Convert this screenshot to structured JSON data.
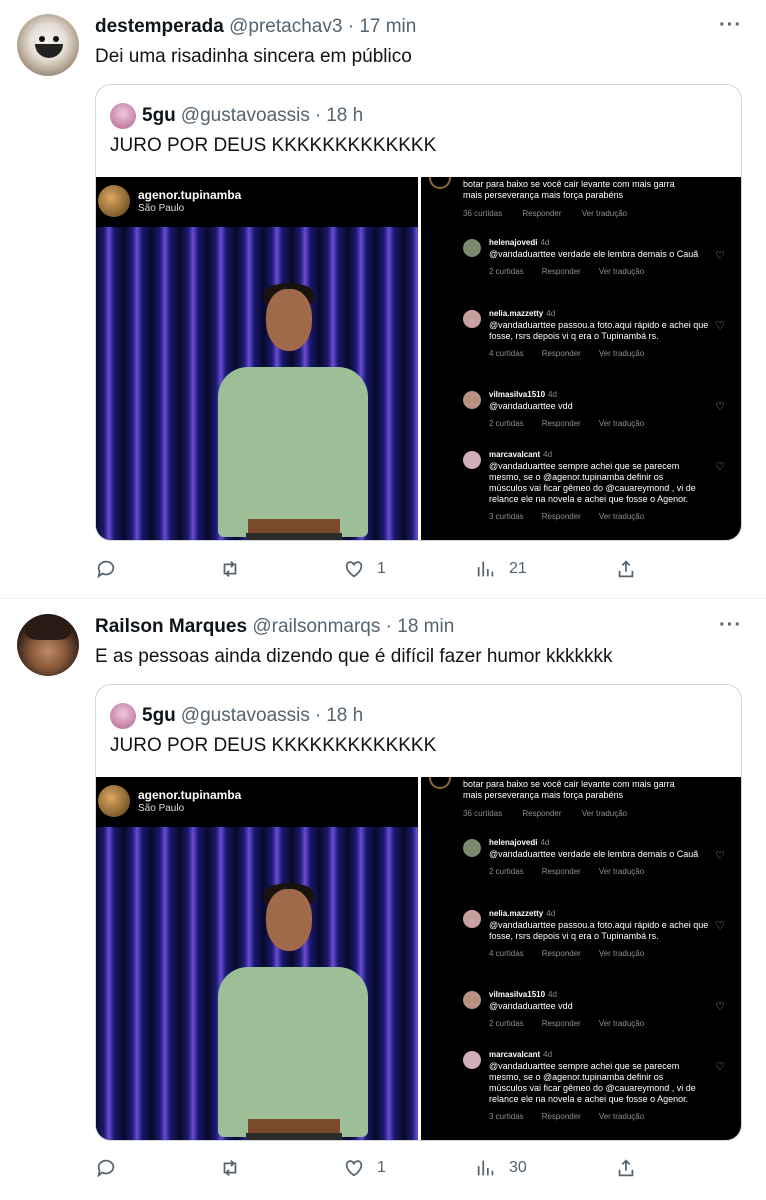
{
  "tweets": [
    {
      "name": "destemperada",
      "handle": "@pretachav3",
      "time": "17 min",
      "text": "Dei uma risadinha sincera em público",
      "quote": {
        "name": "5gu",
        "handle": "@gustavoassis",
        "time": "18 h",
        "text": "JURO POR DEUS KKKKKKKKKKKKK"
      },
      "stats": {
        "replies": "",
        "retweets": "",
        "likes": "1",
        "views": "21"
      }
    },
    {
      "name": "Railson Marques",
      "handle": "@railsonmarqs",
      "time": "18 min",
      "text": "E as pessoas ainda dizendo que é difícil fazer humor kkkkkkk",
      "quote": {
        "name": "5gu",
        "handle": "@gustavoassis",
        "time": "18 h",
        "text": "JURO POR DEUS KKKKKKKKKKKKK"
      },
      "stats": {
        "replies": "",
        "retweets": "",
        "likes": "1",
        "views": "30"
      }
    }
  ],
  "media": {
    "ig_user": "agenor.tupinamba",
    "ig_location": "São Paulo",
    "top_comment_1": "botar para baixo se você cair levante com mais garra",
    "top_comment_2": "mais perseverança mais força parabéns",
    "top_meta": {
      "likes": "36 curtidas",
      "reply": "Responder",
      "translate": "Ver tradução"
    },
    "comments": [
      {
        "user": "helenajovedi",
        "age": "4d",
        "text": "@vandaduarttee verdade ele lembra demais o Cauã",
        "likes": "2 curtidas"
      },
      {
        "user": "nelia.mazzetty",
        "age": "4d",
        "text": "@vandaduarttee passou.a foto.aqui rápido e achei que  fosse, rsrs depois vi q era o Tupinambá rs.",
        "likes": "4 curtidas"
      },
      {
        "user": "vilmasilva1510",
        "age": "4d",
        "text": "@vandaduarttee vdd",
        "likes": "2 curtidas"
      },
      {
        "user": "marcavalcant",
        "age": "4d",
        "text": "@vandaduarttee sempre achei que se parecem mesmo, se o @agenor.tupinamba definir os músculos vai ficar gêmeo do @cauareymond , vi de relance ele na novela e achei que fosse o Agenor.",
        "likes": "3 curtidas"
      }
    ],
    "reply_label": "Responder",
    "translate_label": "Ver tradução"
  },
  "icons": {
    "more": "more-dots-icon",
    "reply": "reply-icon",
    "retweet": "retweet-icon",
    "like": "like-icon",
    "views": "views-icon",
    "share": "share-icon"
  },
  "colors": {
    "secondary": "#536471",
    "border": "#cfd9de"
  }
}
